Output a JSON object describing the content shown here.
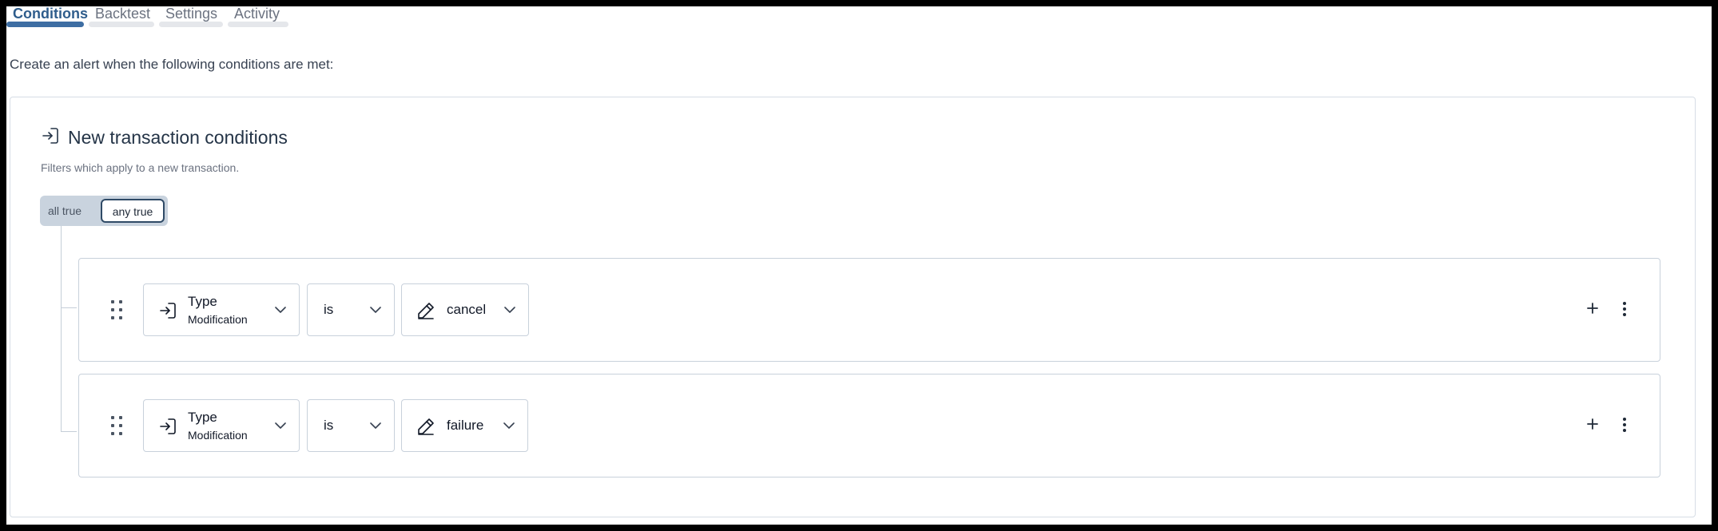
{
  "tabs": [
    {
      "label": "Conditions",
      "active": true
    },
    {
      "label": "Backtest",
      "active": false
    },
    {
      "label": "Settings",
      "active": false
    },
    {
      "label": "Activity",
      "active": false
    }
  ],
  "intro_text": "Create an alert when the following conditions are met:",
  "section": {
    "icon": "sign-in-icon",
    "title": "New transaction conditions",
    "subtitle": "Filters which apply to a new transaction."
  },
  "logic_toggle": {
    "options": [
      "all true",
      "any true"
    ],
    "selected": "any true"
  },
  "conditions": [
    {
      "field_icon": "sign-in-icon",
      "field_label": "Type",
      "field_sub": "Modification",
      "operator": "is",
      "value_icon": "pencil-icon",
      "value": "cancel"
    },
    {
      "field_icon": "sign-in-icon",
      "field_label": "Type",
      "field_sub": "Modification",
      "operator": "is",
      "value_icon": "pencil-icon",
      "value": "failure"
    }
  ],
  "colors": {
    "accent": "#3e6ea3",
    "active_tab_text": "#2f5d8c",
    "border": "#c8d1db",
    "toggle_bg": "#c9d3de",
    "toggle_selected_border": "#2f4a66"
  }
}
